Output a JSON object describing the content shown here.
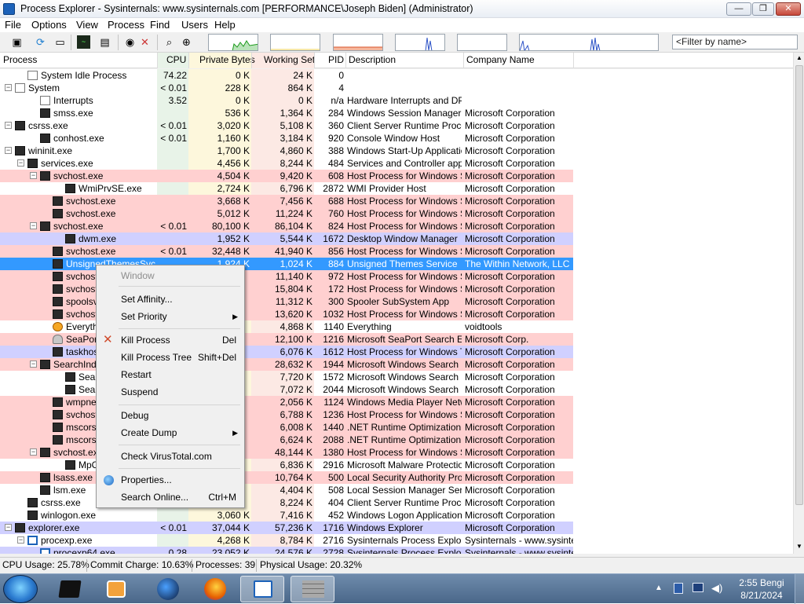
{
  "window": {
    "title": "Process Explorer - Sysinternals: www.sysinternals.com [PERFORMANCE\\Joseph Biden] (Administrator)",
    "controls": {
      "minimize": "—",
      "maximize": "❐",
      "close": "✕"
    }
  },
  "menu": [
    "File",
    "Options",
    "View",
    "Process",
    "Find",
    "Users",
    "Help"
  ],
  "filter": {
    "placeholder": "<Filter by name>"
  },
  "columns": {
    "process": "Process",
    "cpu": "CPU",
    "private_bytes": "Private Bytes",
    "working_set": "Working Set",
    "pid": "PID",
    "description": "Description",
    "company": "Company Name"
  },
  "colors": {
    "service": "#ffd0d0",
    "own_process": "#d0d0ff",
    "selected": "#3399ff",
    "cpu_col": "#e8f3e8",
    "private_col": "#fdf7dc",
    "working_col": "#fce9e4"
  },
  "processes": [
    {
      "name": "System Idle Process",
      "cpu": "74.22",
      "priv": "0 K",
      "ws": "24 K",
      "pid": "0",
      "desc": "",
      "company": "",
      "indent": 1,
      "toggle": "",
      "icon": "light",
      "bg": ""
    },
    {
      "name": "System",
      "cpu": "< 0.01",
      "priv": "228 K",
      "ws": "864 K",
      "pid": "4",
      "desc": "",
      "company": "",
      "indent": 0,
      "toggle": "−",
      "icon": "light",
      "bg": ""
    },
    {
      "name": "Interrupts",
      "cpu": "3.52",
      "priv": "0 K",
      "ws": "0 K",
      "pid": "n/a",
      "desc": "Hardware Interrupts and DPCs",
      "company": "",
      "indent": 2,
      "toggle": "",
      "icon": "light",
      "bg": ""
    },
    {
      "name": "smss.exe",
      "cpu": "",
      "priv": "536 K",
      "ws": "1,364 K",
      "pid": "284",
      "desc": "Windows Session Manager",
      "company": "Microsoft Corporation",
      "indent": 2,
      "toggle": "",
      "icon": "dark",
      "bg": ""
    },
    {
      "name": "csrss.exe",
      "cpu": "< 0.01",
      "priv": "3,020 K",
      "ws": "5,108 K",
      "pid": "360",
      "desc": "Client Server Runtime Process",
      "company": "Microsoft Corporation",
      "indent": 0,
      "toggle": "−",
      "icon": "dark",
      "bg": ""
    },
    {
      "name": "conhost.exe",
      "cpu": "< 0.01",
      "priv": "1,160 K",
      "ws": "3,184 K",
      "pid": "920",
      "desc": "Console Window Host",
      "company": "Microsoft Corporation",
      "indent": 2,
      "toggle": "",
      "icon": "dark",
      "bg": ""
    },
    {
      "name": "wininit.exe",
      "cpu": "",
      "priv": "1,700 K",
      "ws": "4,860 K",
      "pid": "388",
      "desc": "Windows Start-Up Application",
      "company": "Microsoft Corporation",
      "indent": 0,
      "toggle": "−",
      "icon": "dark",
      "bg": ""
    },
    {
      "name": "services.exe",
      "cpu": "",
      "priv": "4,456 K",
      "ws": "8,244 K",
      "pid": "484",
      "desc": "Services and Controller app",
      "company": "Microsoft Corporation",
      "indent": 1,
      "toggle": "−",
      "icon": "dark",
      "bg": ""
    },
    {
      "name": "svchost.exe",
      "cpu": "",
      "priv": "4,504 K",
      "ws": "9,420 K",
      "pid": "608",
      "desc": "Host Process for Windows S...",
      "company": "Microsoft Corporation",
      "indent": 2,
      "toggle": "−",
      "icon": "dark",
      "bg": "pink"
    },
    {
      "name": "WmiPrvSE.exe",
      "cpu": "",
      "priv": "2,724 K",
      "ws": "6,796 K",
      "pid": "2872",
      "desc": "WMI Provider Host",
      "company": "Microsoft Corporation",
      "indent": 4,
      "toggle": "",
      "icon": "dark",
      "bg": ""
    },
    {
      "name": "svchost.exe",
      "cpu": "",
      "priv": "3,668 K",
      "ws": "7,456 K",
      "pid": "688",
      "desc": "Host Process for Windows S...",
      "company": "Microsoft Corporation",
      "indent": 3,
      "toggle": "",
      "icon": "dark",
      "bg": "pink"
    },
    {
      "name": "svchost.exe",
      "cpu": "",
      "priv": "5,012 K",
      "ws": "11,224 K",
      "pid": "760",
      "desc": "Host Process for Windows S...",
      "company": "Microsoft Corporation",
      "indent": 3,
      "toggle": "",
      "icon": "dark",
      "bg": "pink"
    },
    {
      "name": "svchost.exe",
      "cpu": "< 0.01",
      "priv": "80,100 K",
      "ws": "86,104 K",
      "pid": "824",
      "desc": "Host Process for Windows S...",
      "company": "Microsoft Corporation",
      "indent": 2,
      "toggle": "−",
      "icon": "dark",
      "bg": "pink"
    },
    {
      "name": "dwm.exe",
      "cpu": "",
      "priv": "1,952 K",
      "ws": "5,544 K",
      "pid": "1672",
      "desc": "Desktop Window Manager",
      "company": "Microsoft Corporation",
      "indent": 4,
      "toggle": "",
      "icon": "dark",
      "bg": "lav"
    },
    {
      "name": "svchost.exe",
      "cpu": "< 0.01",
      "priv": "32,448 K",
      "ws": "41,940 K",
      "pid": "856",
      "desc": "Host Process for Windows S...",
      "company": "Microsoft Corporation",
      "indent": 3,
      "toggle": "",
      "icon": "dark",
      "bg": "pink"
    },
    {
      "name": "UnsignedThemesSvc.exe",
      "cpu": "",
      "priv": "1,924 K",
      "ws": "1,024 K",
      "pid": "884",
      "desc": "Unsigned Themes Service",
      "company": "The Within Network, LLC",
      "indent": 3,
      "toggle": "",
      "icon": "dark",
      "bg": "sel"
    },
    {
      "name": "svchost.exe",
      "cpu": "",
      "priv": "",
      "ws": "11,140 K",
      "pid": "972",
      "desc": "Host Process for Windows S...",
      "company": "Microsoft Corporation",
      "indent": 3,
      "toggle": "",
      "icon": "dark",
      "bg": "pink"
    },
    {
      "name": "svchost.exe",
      "cpu": "",
      "priv": "",
      "ws": "15,804 K",
      "pid": "172",
      "desc": "Host Process for Windows S...",
      "company": "Microsoft Corporation",
      "indent": 3,
      "toggle": "",
      "icon": "dark",
      "bg": "pink"
    },
    {
      "name": "spoolsv.exe",
      "cpu": "",
      "priv": "",
      "ws": "11,312 K",
      "pid": "300",
      "desc": "Spooler SubSystem App",
      "company": "Microsoft Corporation",
      "indent": 3,
      "toggle": "",
      "icon": "dark",
      "bg": "pink"
    },
    {
      "name": "svchost.exe",
      "cpu": "",
      "priv": "",
      "ws": "13,620 K",
      "pid": "1032",
      "desc": "Host Process for Windows S...",
      "company": "Microsoft Corporation",
      "indent": 3,
      "toggle": "",
      "icon": "dark",
      "bg": "pink"
    },
    {
      "name": "Everything.exe",
      "cpu": "",
      "priv": "",
      "ws": "4,868 K",
      "pid": "1140",
      "desc": "Everything",
      "company": "voidtools",
      "indent": 3,
      "toggle": "",
      "icon": "search",
      "bg": ""
    },
    {
      "name": "SeaPort.exe",
      "cpu": "",
      "priv": "",
      "ws": "12,100 K",
      "pid": "1216",
      "desc": "Microsoft SeaPort Search En...",
      "company": "Microsoft Corp.",
      "indent": 3,
      "toggle": "",
      "icon": "person",
      "bg": "pink"
    },
    {
      "name": "taskhost.exe",
      "cpu": "",
      "priv": "",
      "ws": "6,076 K",
      "pid": "1612",
      "desc": "Host Process for Windows T...",
      "company": "Microsoft Corporation",
      "indent": 3,
      "toggle": "",
      "icon": "dark",
      "bg": "lav"
    },
    {
      "name": "SearchIndexer.exe",
      "cpu": "",
      "priv": "",
      "ws": "28,632 K",
      "pid": "1944",
      "desc": "Microsoft Windows Search I...",
      "company": "Microsoft Corporation",
      "indent": 2,
      "toggle": "−",
      "icon": "dark",
      "bg": "pink"
    },
    {
      "name": "SearchProtocolHost.exe",
      "cpu": "",
      "priv": "",
      "ws": "7,720 K",
      "pid": "1572",
      "desc": "Microsoft Windows Search P...",
      "company": "Microsoft Corporation",
      "indent": 4,
      "toggle": "",
      "icon": "dark",
      "bg": ""
    },
    {
      "name": "SearchFilterHost.exe",
      "cpu": "",
      "priv": "",
      "ws": "7,072 K",
      "pid": "2044",
      "desc": "Microsoft Windows Search F...",
      "company": "Microsoft Corporation",
      "indent": 4,
      "toggle": "",
      "icon": "dark",
      "bg": ""
    },
    {
      "name": "wmpnetwk.exe",
      "cpu": "",
      "priv": "",
      "ws": "2,056 K",
      "pid": "1124",
      "desc": "Windows Media Player Netw...",
      "company": "Microsoft Corporation",
      "indent": 3,
      "toggle": "",
      "icon": "dark",
      "bg": "pink"
    },
    {
      "name": "svchost.exe",
      "cpu": "",
      "priv": "",
      "ws": "6,788 K",
      "pid": "1236",
      "desc": "Host Process for Windows S...",
      "company": "Microsoft Corporation",
      "indent": 3,
      "toggle": "",
      "icon": "dark",
      "bg": "pink"
    },
    {
      "name": "mscorsvw.exe",
      "cpu": "",
      "priv": "",
      "ws": "6,008 K",
      "pid": "1440",
      "desc": ".NET Runtime Optimization S...",
      "company": "Microsoft Corporation",
      "indent": 3,
      "toggle": "",
      "icon": "dark",
      "bg": "pink"
    },
    {
      "name": "mscorsvw.exe",
      "cpu": "",
      "priv": "",
      "ws": "6,624 K",
      "pid": "2088",
      "desc": ".NET Runtime Optimization S...",
      "company": "Microsoft Corporation",
      "indent": 3,
      "toggle": "",
      "icon": "dark",
      "bg": "pink"
    },
    {
      "name": "svchost.exe",
      "cpu": "",
      "priv": "",
      "ws": "48,144 K",
      "pid": "1380",
      "desc": "Host Process for Windows S...",
      "company": "Microsoft Corporation",
      "indent": 2,
      "toggle": "−",
      "icon": "dark",
      "bg": "pink"
    },
    {
      "name": "MpCmdRun.exe",
      "cpu": "",
      "priv": "",
      "ws": "6,836 K",
      "pid": "2916",
      "desc": "Microsoft Malware Protection...",
      "company": "Microsoft Corporation",
      "indent": 4,
      "toggle": "",
      "icon": "dark",
      "bg": ""
    },
    {
      "name": "lsass.exe",
      "cpu": "",
      "priv": "",
      "ws": "10,764 K",
      "pid": "500",
      "desc": "Local Security Authority Proc...",
      "company": "Microsoft Corporation",
      "indent": 2,
      "toggle": "",
      "icon": "dark",
      "bg": "pink"
    },
    {
      "name": "lsm.exe",
      "cpu": "",
      "priv": "",
      "ws": "4,404 K",
      "pid": "508",
      "desc": "Local Session Manager Serv...",
      "company": "Microsoft Corporation",
      "indent": 2,
      "toggle": "",
      "icon": "dark",
      "bg": ""
    },
    {
      "name": "csrss.exe",
      "cpu": "",
      "priv": "",
      "ws": "8,224 K",
      "pid": "404",
      "desc": "Client Server Runtime Process",
      "company": "Microsoft Corporation",
      "indent": 1,
      "toggle": "",
      "icon": "dark",
      "bg": ""
    },
    {
      "name": "winlogon.exe",
      "cpu": "",
      "priv": "3,060 K",
      "ws": "7,416 K",
      "pid": "452",
      "desc": "Windows Logon Application",
      "company": "Microsoft Corporation",
      "indent": 1,
      "toggle": "",
      "icon": "dark",
      "bg": ""
    },
    {
      "name": "explorer.exe",
      "cpu": "< 0.01",
      "priv": "37,044 K",
      "ws": "57,236 K",
      "pid": "1716",
      "desc": "Windows Explorer",
      "company": "Microsoft Corporation",
      "indent": 0,
      "toggle": "−",
      "icon": "dark",
      "bg": "lav"
    },
    {
      "name": "procexp.exe",
      "cpu": "",
      "priv": "4,268 K",
      "ws": "8,784 K",
      "pid": "2716",
      "desc": "Sysinternals Process Explorer",
      "company": "Sysinternals - www.sysinter...",
      "indent": 1,
      "toggle": "−",
      "icon": "blue",
      "bg": ""
    },
    {
      "name": "procexp64.exe",
      "cpu": "0.28",
      "priv": "23,052 K",
      "ws": "24,576 K",
      "pid": "2728",
      "desc": "Sysinternals Process Explorer",
      "company": "Sysinternals - www.sysinter...",
      "indent": 2,
      "toggle": "",
      "icon": "blue",
      "bg": "lav"
    }
  ],
  "context_menu": {
    "window": "Window",
    "set_affinity": "Set Affinity...",
    "set_priority": "Set Priority",
    "kill_process": "Kill Process",
    "kill_process_shortcut": "Del",
    "kill_process_tree": "Kill Process Tree",
    "kill_process_tree_shortcut": "Shift+Del",
    "restart": "Restart",
    "suspend": "Suspend",
    "debug": "Debug",
    "create_dump": "Create Dump",
    "check_virustotal": "Check VirusTotal.com",
    "properties": "Properties...",
    "search_online": "Search Online...",
    "search_online_shortcut": "Ctrl+M"
  },
  "status": {
    "cpu_usage": "CPU Usage: 25.78%",
    "commit_charge": "Commit Charge: 10.63%",
    "processes": "Processes: 39",
    "physical_usage": "Physical Usage: 20.32%"
  },
  "taskbar": {
    "time": "2:55 Bengi",
    "date": "8/21/2024"
  }
}
